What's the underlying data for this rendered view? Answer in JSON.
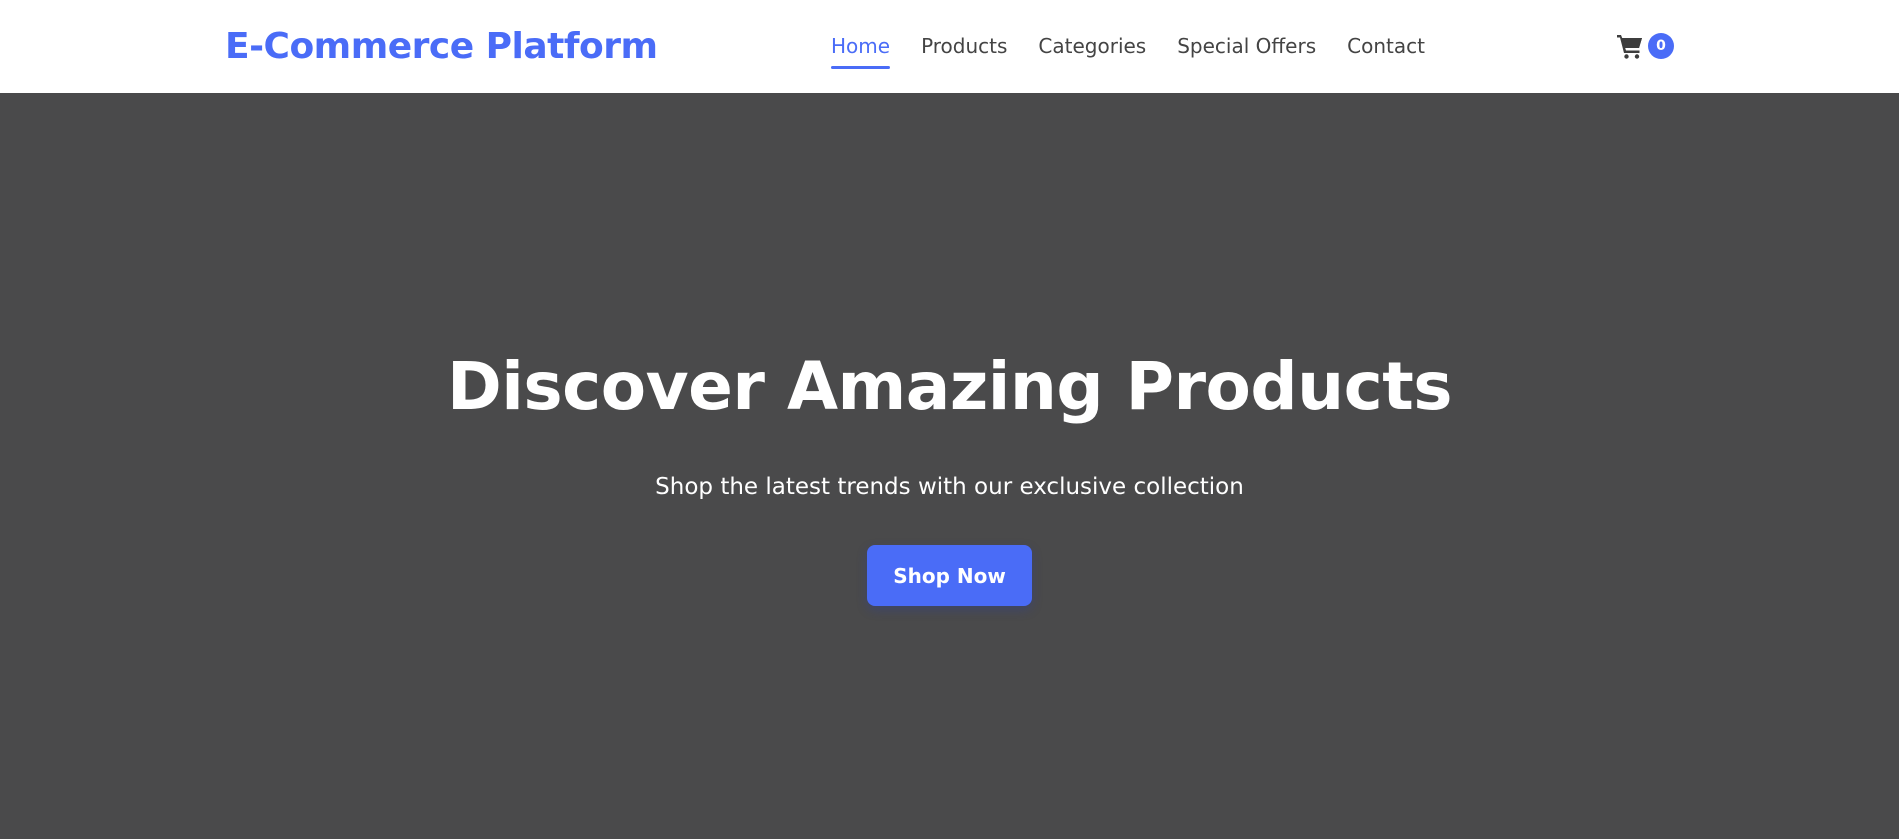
{
  "header": {
    "logo": "E-Commerce Platform",
    "nav": [
      {
        "label": "Home",
        "active": true
      },
      {
        "label": "Products"
      },
      {
        "label": "Categories"
      },
      {
        "label": "Special Offers"
      },
      {
        "label": "Contact"
      }
    ],
    "cart": {
      "icon": "shopping-cart-icon",
      "count": "0"
    }
  },
  "hero": {
    "title": "Discover Amazing Products",
    "subtitle": "Shop the latest trends with our exclusive collection",
    "cta_label": "Shop Now"
  },
  "colors": {
    "accent": "#4a6cf7",
    "hero_background": "#4a4a4b",
    "header_background": "#ffffff",
    "nav_text": "#444444"
  }
}
